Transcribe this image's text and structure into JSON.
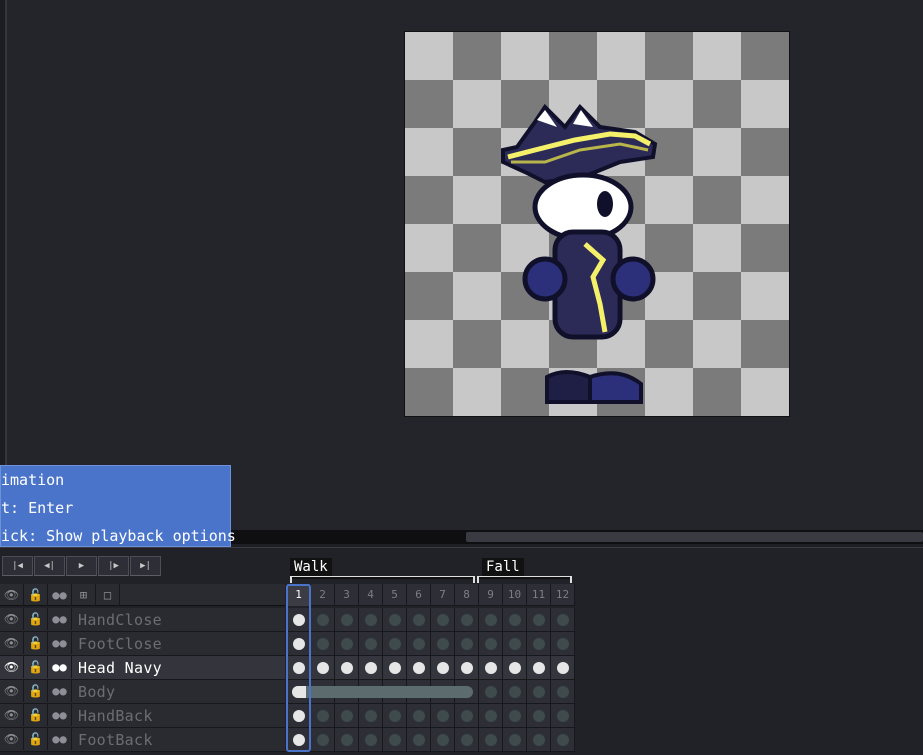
{
  "tooltip": {
    "line1": "imation",
    "line2": "t: Enter",
    "line3": "ick: Show playback options"
  },
  "playback": {
    "first_icon": "first-frame-icon",
    "prev_icon": "previous-frame-icon",
    "play_icon": "play-icon",
    "next_icon": "next-frame-icon",
    "last_icon": "last-frame-icon"
  },
  "tags": [
    {
      "label": "Walk"
    },
    {
      "label": "Fall"
    }
  ],
  "layer_header_icons": [
    "eye-icon",
    "lock-icon",
    "continuous-icon",
    "group-icon",
    "new-layer-icon"
  ],
  "layers": [
    {
      "name": "HandClose",
      "active": false
    },
    {
      "name": "FootClose",
      "active": false
    },
    {
      "name": "Head Navy",
      "active": true
    },
    {
      "name": "Body",
      "active": false
    },
    {
      "name": "HandBack",
      "active": false
    },
    {
      "name": "FootBack",
      "active": false
    }
  ],
  "frames": [
    "1",
    "2",
    "3",
    "4",
    "5",
    "6",
    "7",
    "8",
    "9",
    "10",
    "11",
    "12"
  ],
  "current_frame": "1",
  "colors": {
    "tooltip_bg": "#4a74c9",
    "accent": "#4a74c9",
    "timeline_bg": "#212228",
    "canvas_bg": "#24252b"
  }
}
